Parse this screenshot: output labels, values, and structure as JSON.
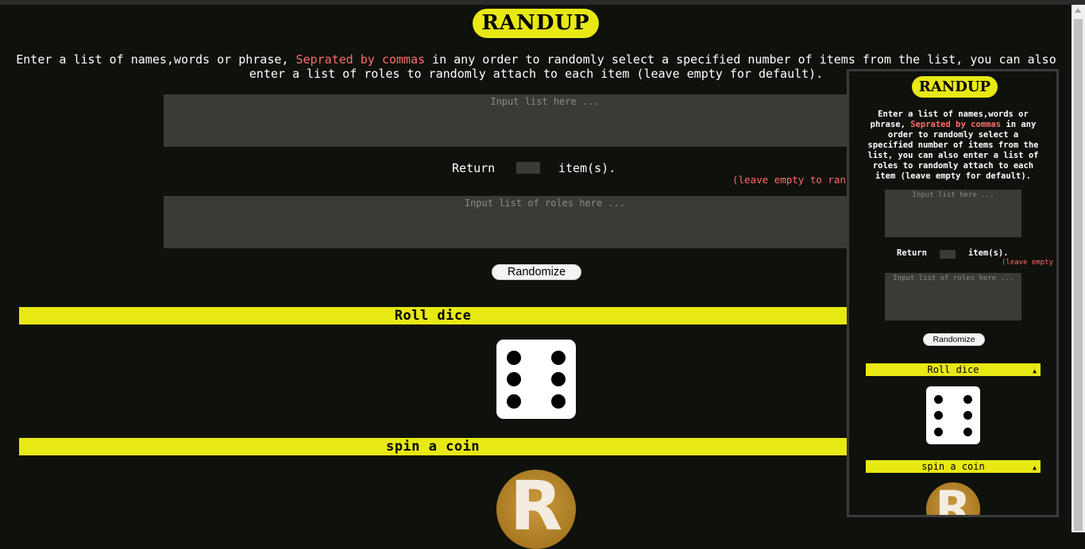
{
  "app": {
    "title": "RANDUP"
  },
  "intro": {
    "part1": "Enter a list of names,words or phrase, ",
    "highlight": "Seprated by commas",
    "part2": " in any order to randomly select a specified number of items from the list, you can also enter a list of roles to randomly attach to each item (leave empty for default)."
  },
  "inputs": {
    "list_placeholder": "Input list here ...",
    "roles_placeholder": "Input list of roles here ...",
    "return_label": "Return",
    "items_label": "item(s).",
    "leave_empty_note": "(leave empty to ran",
    "randomize_label": "Randomize"
  },
  "sections": {
    "dice_title": "Roll dice",
    "dice_value": 6,
    "coin_title": "spin a coin",
    "coin_letter": "R"
  },
  "overlay": {
    "title": "RANDUP",
    "intro_part1": "Enter a list of names,words or phrase, ",
    "intro_highlight": "Seprated by commas",
    "intro_part2": " in any order to randomly select a specified number of items from the list, you can also enter a list of roles to randomly attach to each item (leave empty for default).",
    "list_placeholder": "Input list here ...",
    "roles_placeholder": "Input list of roles here ...",
    "return_label": "Return",
    "items_label": "item(s).",
    "leave_empty_note": "(leave empty",
    "randomize_label": "Randomize",
    "dice_title": "Roll dice",
    "coin_title": "spin a coin",
    "collapse_icon": "▲"
  },
  "colors": {
    "accent_yellow": "#e8e814",
    "highlight_red": "#ff6b6b",
    "background": "#0f110c",
    "input_bg": "#3a3b36"
  }
}
